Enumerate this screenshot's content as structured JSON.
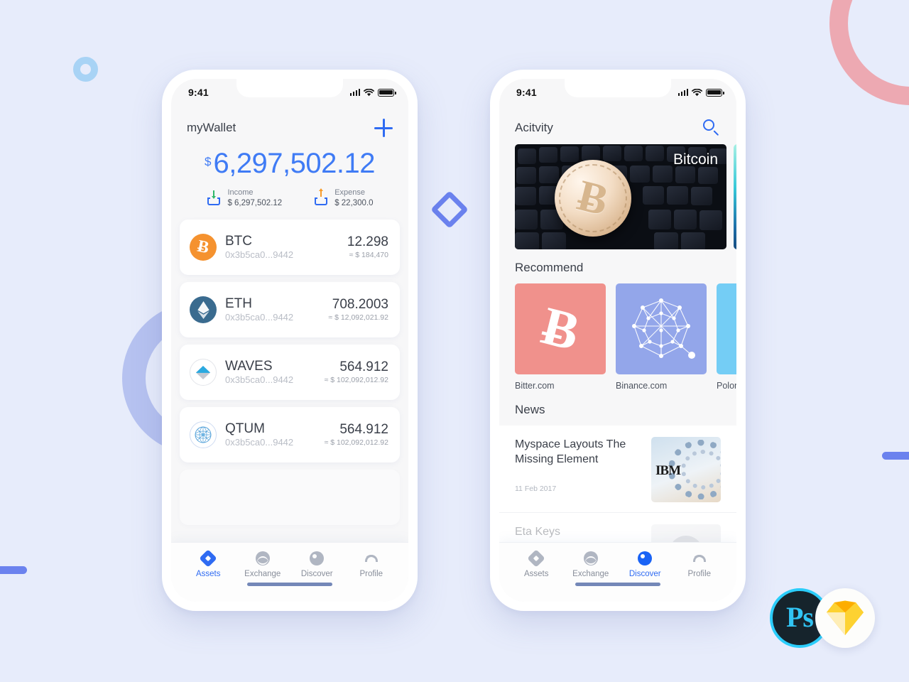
{
  "background": {
    "color": "#e7ecfb",
    "accents": {
      "ring_blue": "#a8d3f5",
      "arc_pink": "#eda9b2",
      "arc_periwinkle": "#b6c2f0",
      "bar_blue": "#6b82ee",
      "diamond_blue": "#6b82ee"
    }
  },
  "badges": {
    "photoshop": {
      "label": "Ps",
      "ring_color": "#2bcdfa",
      "bg": "#16242c"
    },
    "sketch": {
      "label": "Sketch",
      "gem_colors": [
        "#fdb913",
        "#f7941e",
        "#fecb2e"
      ]
    }
  },
  "phone1": {
    "status": {
      "time": "9:41",
      "signal_icon": "signal-bars-icon",
      "wifi_icon": "wifi-icon",
      "battery_icon": "battery-icon"
    },
    "header": {
      "title": "myWallet",
      "add_icon": "plus-icon"
    },
    "balance": {
      "currency_symbol": "$",
      "amount": "6,297,502.12",
      "color": "#3f7bf5"
    },
    "summary": [
      {
        "icon": "income-tray-down-icon",
        "label": "Income",
        "value": "$ 6,297,502.12",
        "arrow_color": "#31b86a"
      },
      {
        "icon": "expense-tray-up-icon",
        "label": "Expense",
        "value": "$ 22,300.0",
        "arrow_color": "#f79c2b"
      }
    ],
    "assets": [
      {
        "icon": "btc-coin-icon",
        "symbol": "B",
        "name": "BTC",
        "address": "0x3b5ca0...9442",
        "amount": "12.298",
        "fiat": "≈ $ 184,470",
        "color": "#f5922f"
      },
      {
        "icon": "eth-coin-icon",
        "symbol": "◆",
        "name": "ETH",
        "address": "0x3b5ca0...9442",
        "amount": "708.2003",
        "fiat": "≈ $ 12,092,021.92",
        "color": "#3a6b8f"
      },
      {
        "icon": "waves-coin-icon",
        "symbol": "▲",
        "name": "WAVES",
        "address": "0x3b5ca0...9442",
        "amount": "564.912",
        "fiat": "≈ $ 102,092,012.92",
        "color": "#2aa9e0"
      },
      {
        "icon": "qtum-coin-icon",
        "symbol": "⬤",
        "name": "QTUM",
        "address": "0x3b5ca0...9442",
        "amount": "564.912",
        "fiat": "≈ $ 102,092,012.92",
        "color": "#2e9ad0"
      }
    ],
    "tabs": [
      {
        "icon": "assets-diamond-icon",
        "label": "Assets",
        "active": true
      },
      {
        "icon": "exchange-waves-icon",
        "label": "Exchange",
        "active": false
      },
      {
        "icon": "discover-compass-icon",
        "label": "Discover",
        "active": false
      },
      {
        "icon": "profile-person-icon",
        "label": "Profile",
        "active": false
      }
    ]
  },
  "phone2": {
    "status": {
      "time": "9:41",
      "signal_icon": "signal-bars-icon",
      "wifi_icon": "wifi-icon",
      "battery_icon": "battery-icon"
    },
    "header": {
      "title": "Acitvity",
      "search_icon": "search-icon"
    },
    "hero": {
      "label": "Bitcoin"
    },
    "recommend": {
      "title": "Recommend",
      "items": [
        {
          "name": "Bitter.com",
          "icon": "bitcoin-b-icon",
          "color": "#f0918c"
        },
        {
          "name": "Binance.com",
          "icon": "network-graph-icon",
          "color": "#93a6ea"
        },
        {
          "name": "Polonie",
          "icon": "exchange-icon",
          "color": "#74cdf5"
        }
      ]
    },
    "news": {
      "title": "News",
      "items": [
        {
          "title": "Myspace Layouts The Missing Element",
          "date": "11 Feb 2017",
          "thumb": "ibm-servers-thumb"
        },
        {
          "title": "Eta Keys",
          "date": "",
          "thumb": "avatar-thumb"
        }
      ]
    },
    "tabs": [
      {
        "icon": "assets-diamond-icon",
        "label": "Assets",
        "active": false
      },
      {
        "icon": "exchange-waves-icon",
        "label": "Exchange",
        "active": false
      },
      {
        "icon": "discover-compass-icon",
        "label": "Discover",
        "active": true
      },
      {
        "icon": "profile-person-icon",
        "label": "Profile",
        "active": false
      }
    ]
  }
}
